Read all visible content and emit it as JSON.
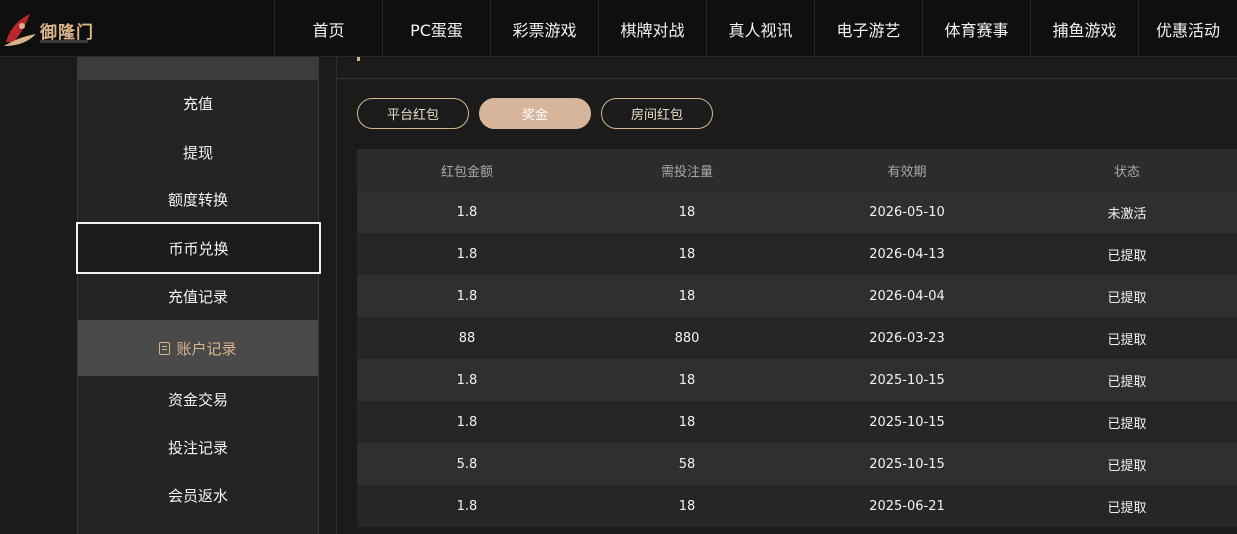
{
  "brand": {
    "name": "御隆门"
  },
  "nav": [
    "首页",
    "PC蛋蛋",
    "彩票游戏",
    "棋牌对战",
    "真人视讯",
    "电子游艺",
    "体育赛事",
    "捕鱼游戏",
    "优惠活动"
  ],
  "sidebar": {
    "items": [
      "充值",
      "提现",
      "额度转换",
      "币币兑换",
      "充值记录"
    ],
    "group_label": "账户记录",
    "group_items": [
      "资金交易",
      "投注记录",
      "会员返水"
    ]
  },
  "tabs": [
    "平台红包",
    "奖金",
    "房间红包"
  ],
  "table": {
    "headers": [
      "红包金额",
      "需投注量",
      "有效期",
      "状态"
    ],
    "rows": [
      [
        "1.8",
        "18",
        "2026-05-10",
        "未激活"
      ],
      [
        "1.8",
        "18",
        "2026-04-13",
        "已提取"
      ],
      [
        "1.8",
        "18",
        "2026-04-04",
        "已提取"
      ],
      [
        "88",
        "880",
        "2026-03-23",
        "已提取"
      ],
      [
        "1.8",
        "18",
        "2025-10-15",
        "已提取"
      ],
      [
        "1.8",
        "18",
        "2025-10-15",
        "已提取"
      ],
      [
        "5.8",
        "58",
        "2025-10-15",
        "已提取"
      ],
      [
        "1.8",
        "18",
        "2025-06-21",
        "已提取"
      ]
    ]
  },
  "colors": {
    "accent": "#d7b48a",
    "tab_active": "#d7b59b"
  }
}
